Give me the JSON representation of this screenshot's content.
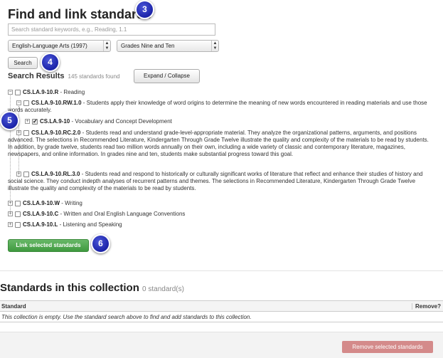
{
  "page": {
    "title": "Find and link standards"
  },
  "search": {
    "placeholder": "Search standard keywords, e.g., Reading, 1.1",
    "button_label": "Search"
  },
  "filters": {
    "subject_selected": "English-Language Arts (1997)",
    "grade_selected": "Grades Nine and Ten"
  },
  "callouts": {
    "c3": "3",
    "c4": "4",
    "c5": "5",
    "c6": "6"
  },
  "results": {
    "heading": "Search Results",
    "count": "145 standards found",
    "expand_collapse_label": "Expand / Collapse"
  },
  "tree": {
    "r": {
      "code": "CS.LA.9-10.R",
      "text": " - Reading"
    },
    "rw1": {
      "code": "CS.LA.9-10.RW.1.0",
      "text": " - Students apply their knowledge of word origins to determine the meaning of new words encountered in reading materials and use those words accurately."
    },
    "vocab": {
      "code": "CS.LA.9-10",
      "text": " - Vocabulary and Concept Development"
    },
    "rc2": {
      "code": "CS.LA.9-10.RC.2.0",
      "text": " - Students read and understand grade-level-appropriate material. They analyze the organizational patterns, arguments, and positions advanced. The selections in Recommended Literature, Kindergarten Through Grade Twelve illustrate the quality and complexity of the materials to be read by students. In addition, by grade twelve, students read two million words annually on their own, including a wide variety of classic and contemporary literature, magazines, newspapers, and online information. In grades nine and ten, students make substantial progress toward this goal."
    },
    "rl3": {
      "code": "CS.LA.9-10.RL.3.0",
      "text": " - Students read and respond to historically or culturally significant works of literature that reflect and enhance their studies of history and social science. They conduct indepth analyses of recurrent patterns and themes. The selections in Recommended Literature, Kindergarten Through Grade Twelve illustrate the quality and complexity of the materials to be read by students."
    },
    "w": {
      "code": "CS.LA.9-10.W",
      "text": " - Writing"
    },
    "c": {
      "code": "CS.LA.9-10.C",
      "text": " - Written and Oral English Language Conventions"
    },
    "l": {
      "code": "CS.LA.9-10.L",
      "text": " - Listening and Speaking"
    }
  },
  "link_button_label": "Link selected standards",
  "collection": {
    "title": "Standards in this collection",
    "count": "0 standard(s)",
    "col_standard": "Standard",
    "col_remove": "Remove?",
    "empty_message": "This collection is empty. Use the standard search above to find and add standards to this collection.",
    "remove_button_label": "Remove selected standards"
  },
  "colors": {
    "callout": "#2a33c2",
    "link_button": "#4ea64e",
    "remove_button": "#d48a8a"
  }
}
